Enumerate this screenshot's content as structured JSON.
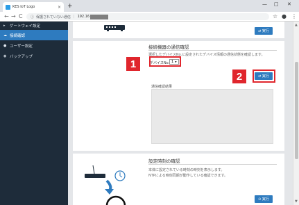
{
  "browser": {
    "tab_title": "KES IoT Logo",
    "tab_close": "×",
    "new_tab": "+",
    "win_minimize": "—",
    "win_maximize": "□",
    "win_close": "✕",
    "back": "←",
    "forward": "→",
    "reload": "C",
    "security_icon": "ⓘ",
    "security_text": "保護されていない通信",
    "url_visible": "192.16",
    "star_icon": "☆",
    "account_icon": "●",
    "menu_icon": "⋮"
  },
  "sidebar": {
    "items": [
      {
        "label": "ゲートウェイ設定",
        "icon": "▸"
      },
      {
        "label": "接続確認",
        "icon": "☁"
      },
      {
        "label": "ユーザー設定",
        "icon": "●"
      },
      {
        "label": "バックアップ",
        "icon": "◉"
      }
    ]
  },
  "sections": {
    "top_button": "⇄ 実行",
    "comm_check": {
      "title": "接続機器の通信確認",
      "description": "選択したデバイスNo.に設定されたデバイス情報の通信状態を確認します。",
      "device_label": "デバイスNo.",
      "device_value": "1",
      "exec_button": "⇄ 実行",
      "result_label": "通信確認結果"
    },
    "time_check": {
      "title": "設定時刻の確認",
      "description_line1": "本体に設定されている時刻の時刻を表示します。",
      "description_line2": "NTPによる時刻同期が動作している確認できます。",
      "exec_button": "⊙ 実行"
    }
  },
  "annotations": {
    "badge_1": "1",
    "badge_2": "2"
  },
  "colors": {
    "sidebar_bg": "#1e2c3a",
    "accent": "#2e7bbf",
    "annotation_red": "#e0262d"
  }
}
